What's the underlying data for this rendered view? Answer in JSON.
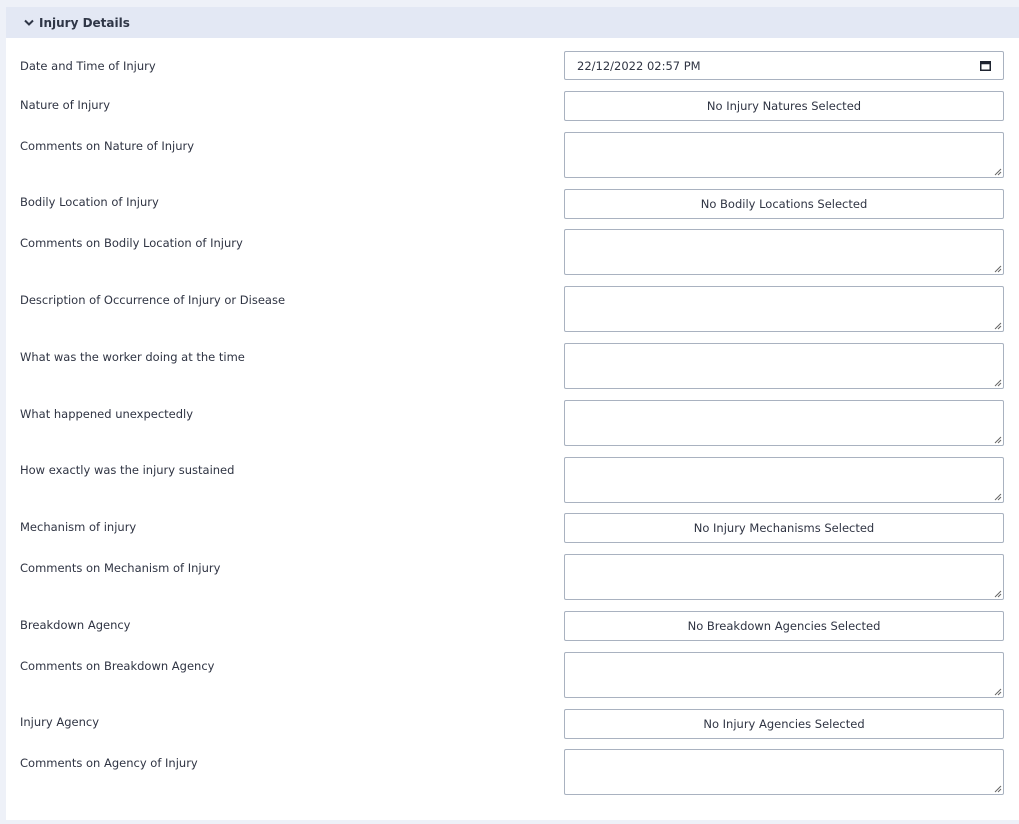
{
  "section": {
    "title": "Injury Details",
    "toggle_icon": "chevron-down-icon"
  },
  "fields": {
    "date_time": {
      "label": "Date and Time of Injury",
      "value": "22/12/2022 02:57 PM",
      "icon": "calendar-icon"
    },
    "nature": {
      "label": "Nature of Injury",
      "button": "No Injury Natures Selected"
    },
    "nature_comments": {
      "label": "Comments on Nature of Injury",
      "value": ""
    },
    "bodily_location": {
      "label": "Bodily Location of Injury",
      "button": "No Bodily Locations Selected"
    },
    "bodily_location_comments": {
      "label": "Comments on Bodily Location of Injury",
      "value": ""
    },
    "occurrence_description": {
      "label": "Description of Occurrence of Injury or Disease",
      "value": ""
    },
    "worker_doing": {
      "label": "What was the worker doing at the time",
      "value": ""
    },
    "happened_unexpectedly": {
      "label": "What happened unexpectedly",
      "value": ""
    },
    "how_sustained": {
      "label": "How exactly was the injury sustained",
      "value": ""
    },
    "mechanism": {
      "label": "Mechanism of injury",
      "button": "No Injury Mechanisms Selected"
    },
    "mechanism_comments": {
      "label": "Comments on Mechanism of Injury",
      "value": ""
    },
    "breakdown_agency": {
      "label": "Breakdown Agency",
      "button": "No Breakdown Agencies Selected"
    },
    "breakdown_agency_comments": {
      "label": "Comments on Breakdown Agency",
      "value": ""
    },
    "injury_agency": {
      "label": "Injury Agency",
      "button": "No Injury Agencies Selected"
    },
    "injury_agency_comments": {
      "label": "Comments on Agency of Injury",
      "value": ""
    }
  },
  "colors": {
    "header_bg": "#e3e8f4",
    "page_bg": "#eef1f8",
    "border": "#a9b2c0",
    "text": "#2f3443"
  }
}
